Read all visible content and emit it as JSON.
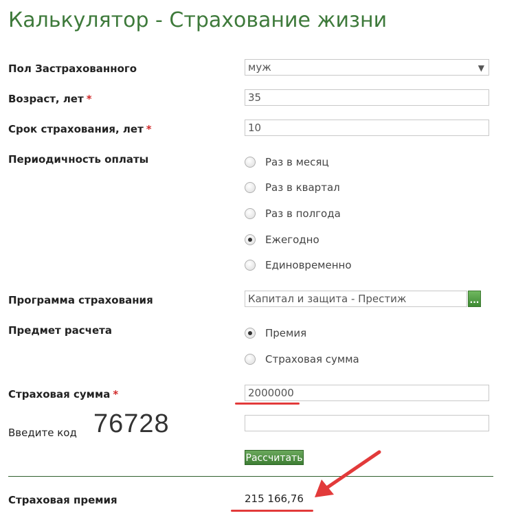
{
  "title": "Калькулятор - Страхование жизни",
  "form": {
    "gender": {
      "label": "Пол Застрахованного",
      "value": "муж"
    },
    "age": {
      "label": "Возраст, лет",
      "required_mark": "*",
      "value": "35"
    },
    "term": {
      "label": "Срок страхования, лет",
      "required_mark": "*",
      "value": "10"
    },
    "payment_frequency": {
      "label": "Периодичность оплаты",
      "options": [
        {
          "label": "Раз в месяц",
          "checked": false
        },
        {
          "label": "Раз в квартал",
          "checked": false
        },
        {
          "label": "Раз в полгода",
          "checked": false
        },
        {
          "label": "Ежегодно",
          "checked": true
        },
        {
          "label": "Единовременно",
          "checked": false
        }
      ]
    },
    "program": {
      "label": "Программа страхования",
      "value": "Капитал и защита - Престиж",
      "button_label": "..."
    },
    "calc_subject": {
      "label": "Предмет расчета",
      "options": [
        {
          "label": "Премия",
          "checked": true
        },
        {
          "label": "Страховая сумма",
          "checked": false
        }
      ]
    },
    "sum_insured": {
      "label": "Страховая сумма",
      "required_mark": "*",
      "value": "2000000"
    },
    "captcha": {
      "label": "Введите код",
      "code": "76728",
      "value": ""
    },
    "calculate_label": "Рассчитать"
  },
  "result": {
    "label": "Страховая премия",
    "value": "215 166,76"
  },
  "colors": {
    "title": "#3e7a3b",
    "required": "#d12a2a",
    "annotation": "#e23a3a",
    "button": "#4a8c3f"
  }
}
